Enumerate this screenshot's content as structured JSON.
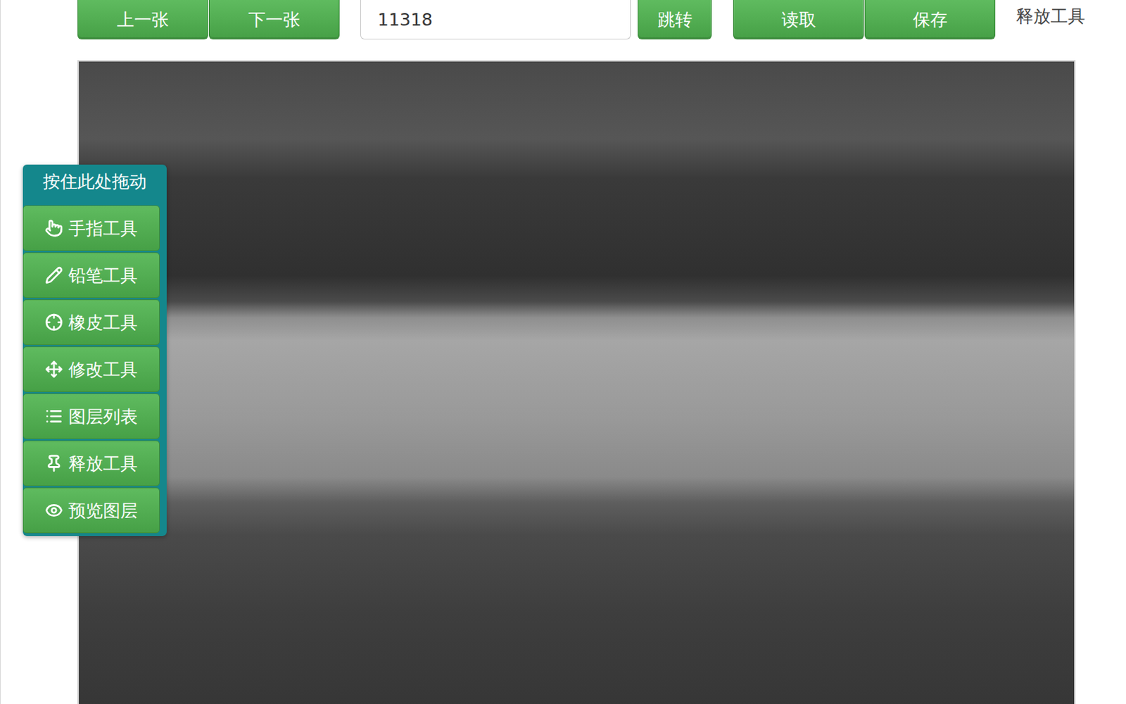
{
  "toolbar": {
    "nav_buttons": [
      "上一张",
      "下一张"
    ],
    "page_input": {
      "value": "11318"
    },
    "jump_button": "跳转",
    "file_buttons": [
      "读取",
      "保存"
    ],
    "current_tool": "释放工具"
  },
  "tool_panel": {
    "handle": "按住此处拖动",
    "tools": [
      {
        "label": "手指工具"
      },
      {
        "label": "铅笔工具"
      },
      {
        "label": "橡皮工具"
      },
      {
        "label": "修改工具"
      },
      {
        "label": "图层列表"
      },
      {
        "label": "释放工具"
      },
      {
        "label": "预览图层"
      }
    ]
  },
  "canvas": {
    "kind": "image"
  }
}
